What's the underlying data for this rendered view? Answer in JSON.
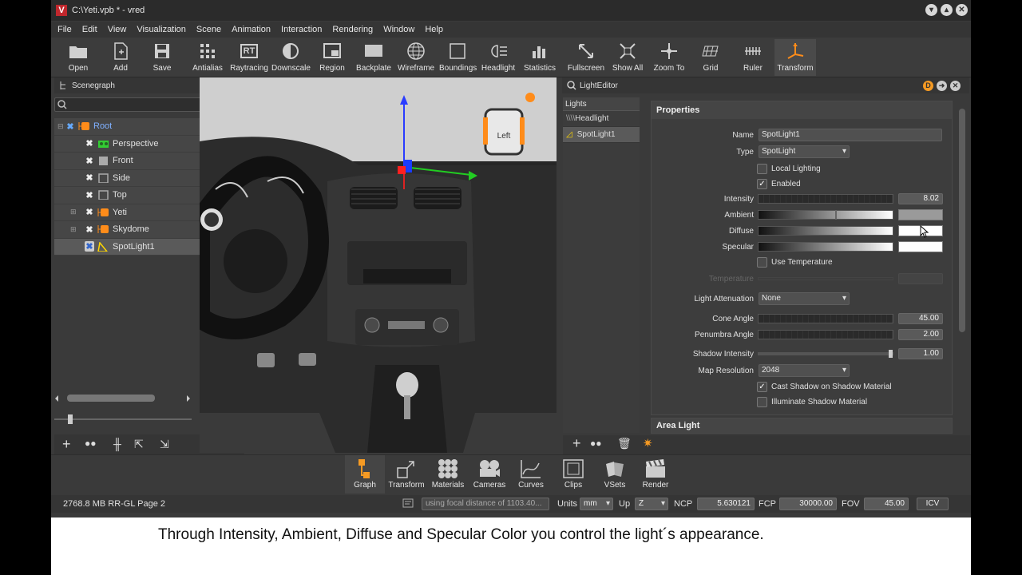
{
  "window": {
    "title": "C:\\Yeti.vpb * - vred",
    "logo": "V"
  },
  "menu": [
    "File",
    "Edit",
    "View",
    "Visualization",
    "Scene",
    "Animation",
    "Interaction",
    "Rendering",
    "Window",
    "Help"
  ],
  "toolbar": {
    "open": "Open",
    "add": "Add",
    "save": "Save",
    "antialias": "Antialias",
    "raytracing": "Raytracing",
    "raytracing_badge": "RT",
    "downscale": "Downscale",
    "region": "Region",
    "backplate": "Backplate",
    "wireframe": "Wireframe",
    "boundings": "Boundings",
    "headlight": "Headlight",
    "statistics": "Statistics",
    "fullscreen": "Fullscreen",
    "show_all": "Show All",
    "zoom_to": "Zoom To",
    "grid": "Grid",
    "ruler": "Ruler",
    "transform": "Transform"
  },
  "scenegraph": {
    "title": "Scenegraph",
    "d_badge": "D",
    "items": [
      {
        "label": "Root",
        "color": "#ff8c1a"
      },
      {
        "label": "Perspective",
        "color": "#3c3"
      },
      {
        "label": "Front",
        "color": "#aaa"
      },
      {
        "label": "Side",
        "color": "#aaa"
      },
      {
        "label": "Top",
        "color": "#aaa"
      },
      {
        "label": "Yeti",
        "color": "#ff8c1a"
      },
      {
        "label": "Skydome",
        "color": "#ff8c1a"
      },
      {
        "label": "SpotLight1",
        "color": "#ffd700"
      }
    ]
  },
  "viewport": {
    "cube_label": "Left"
  },
  "light_editor": {
    "title": "LightEditor",
    "d_badge": "D",
    "lights_header": "Lights",
    "lights": [
      "Headlight",
      "SpotLight1"
    ],
    "properties_title": "Properties",
    "name_label": "Name",
    "name_value": "SpotLight1",
    "type_label": "Type",
    "type_value": "SpotLight",
    "local_lighting": "Local Lighting",
    "enabled": "Enabled",
    "intensity_label": "Intensity",
    "intensity_value": "8.02",
    "ambient_label": "Ambient",
    "ambient_color": "#9a9a9a",
    "diffuse_label": "Diffuse",
    "diffuse_color": "#ffffff",
    "specular_label": "Specular",
    "specular_color": "#ffffff",
    "use_temperature": "Use Temperature",
    "temperature_label": "Temperature",
    "attenuation_label": "Light Attenuation",
    "attenuation_value": "None",
    "cone_label": "Cone Angle",
    "cone_value": "45.00",
    "penumbra_label": "Penumbra Angle",
    "penumbra_value": "2.00",
    "shadow_label": "Shadow Intensity",
    "shadow_value": "1.00",
    "mapres_label": "Map Resolution",
    "mapres_value": "2048",
    "cast_shadow": "Cast Shadow on Shadow Material",
    "illuminate_shadow": "Illuminate Shadow Material",
    "area_light": "Area Light"
  },
  "modules": [
    "Graph",
    "Transform",
    "Materials",
    "Cameras",
    "Curves",
    "Clips",
    "VSets",
    "Render"
  ],
  "status": {
    "memory": "2768.8 MB  RR-GL  Page 2",
    "focal": "using focal distance of 1103.40...",
    "units_label": "Units",
    "units_value": "mm",
    "up_label": "Up",
    "up_value": "Z",
    "ncp_label": "NCP",
    "ncp_value": "5.630121",
    "fcp_label": "FCP",
    "fcp_value": "30000.00",
    "fov_label": "FOV",
    "fov_value": "45.00",
    "icv": "ICV"
  },
  "caption": "Through Intensity,  Ambient, Diffuse and Specular Color you control the light´s appearance."
}
